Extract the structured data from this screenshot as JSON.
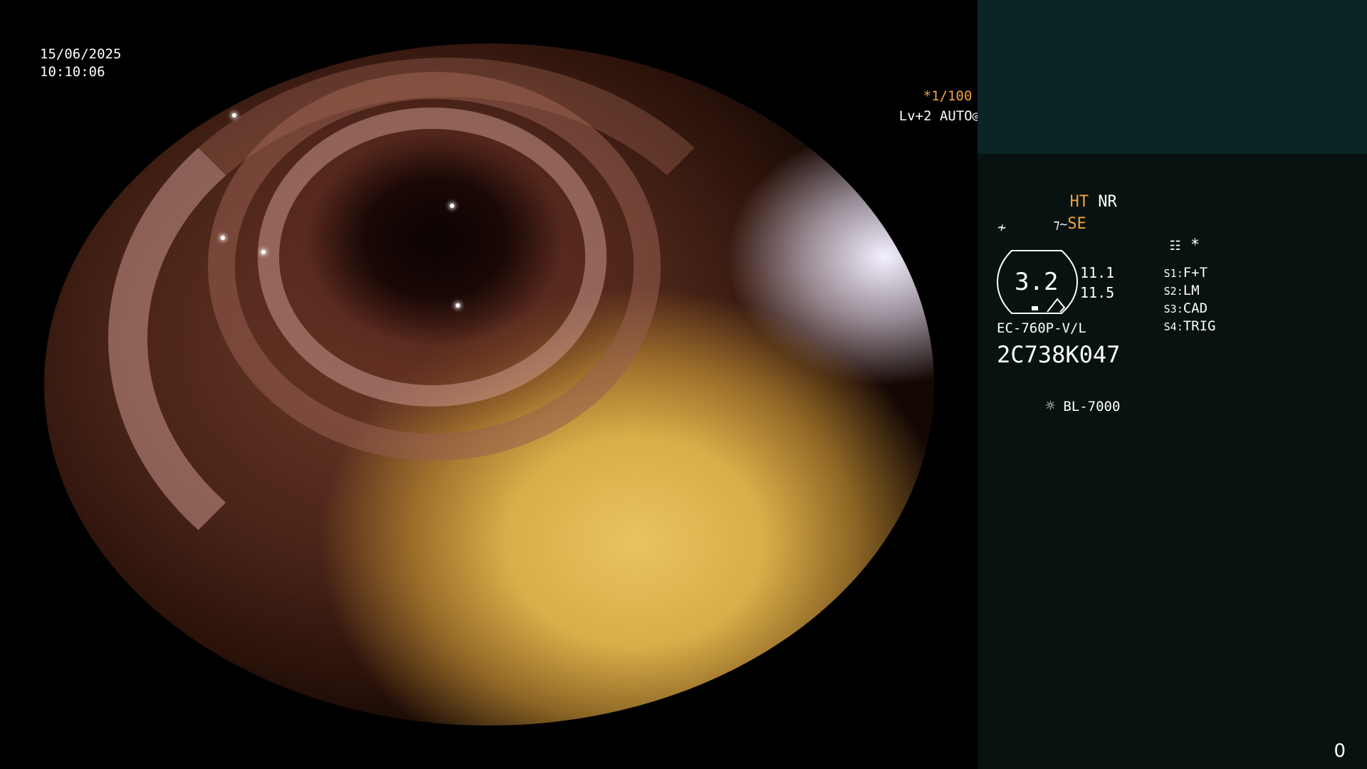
{
  "overlay": {
    "date": "15/06/2025",
    "time": "10:10:06",
    "shutter": "*1/100",
    "level": "Lv+2 AUTO"
  },
  "panel": {
    "mode_ht": "HT",
    "mode_nr": "NR",
    "mode_se": "SE",
    "asterisk": "*",
    "zoom_value": "3.2",
    "value_top": "11.1",
    "value_bottom": "11.5",
    "switches": [
      {
        "key": "S1:",
        "value": "F+T"
      },
      {
        "key": "S2:",
        "value": "LM"
      },
      {
        "key": "S3:",
        "value": "CAD"
      },
      {
        "key": "S4:",
        "value": "TRIG"
      }
    ],
    "scope_model": "EC-760P-V/L",
    "serial": "2C738K047",
    "light_source": "BL-7000"
  },
  "counter": "0",
  "colors": {
    "accent": "#f3a33a",
    "panel_bg": "#071211",
    "panel_top_bg": "#0b2425"
  }
}
